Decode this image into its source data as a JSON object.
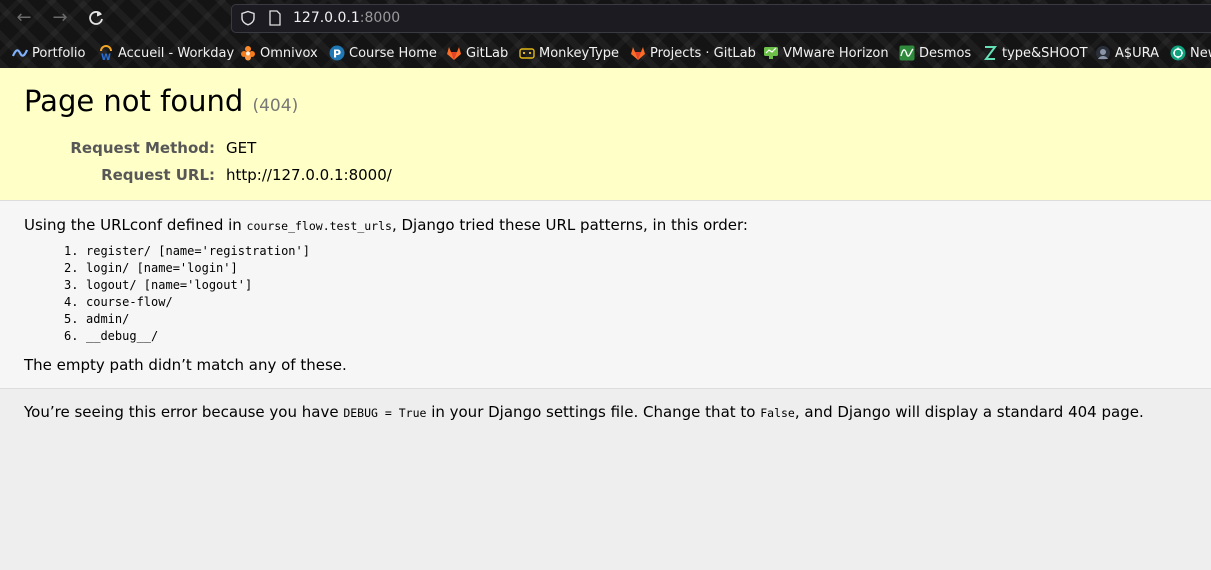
{
  "browser": {
    "url_host": "127.0.0.1",
    "url_port": ":8000",
    "bookmarks": [
      {
        "label": "Portfolio",
        "icon": "portfolio-icon"
      },
      {
        "label": "Accueil - Workday",
        "icon": "workday-icon"
      },
      {
        "label": "Omnivox",
        "icon": "omnivox-icon"
      },
      {
        "label": "Course Home",
        "icon": "pearson-icon"
      },
      {
        "label": "GitLab",
        "icon": "gitlab-icon"
      },
      {
        "label": "MonkeyType",
        "icon": "monkeytype-icon"
      },
      {
        "label": "Projects · GitLab",
        "icon": "gitlab-icon"
      },
      {
        "label": "VMware Horizon",
        "icon": "vmware-horizon-icon"
      },
      {
        "label": "Desmos",
        "icon": "desmos-icon"
      },
      {
        "label": "type&SHOOT",
        "icon": "typeshoot-icon"
      },
      {
        "label": "A$URA",
        "icon": "asura-icon"
      },
      {
        "label": "New",
        "icon": "chatgpt-icon"
      }
    ]
  },
  "summary": {
    "title": "Page not found",
    "code": "(404)",
    "request_method_label": "Request Method:",
    "request_method": "GET",
    "request_url_label": "Request URL:",
    "request_url": "http://127.0.0.1:8000/"
  },
  "info": {
    "intro_before": "Using the URLconf defined in ",
    "urlconf": "course_flow.test_urls",
    "intro_after": ", Django tried these URL patterns, in this order:",
    "patterns": [
      {
        "num": "1.",
        "text": "register/ [name='registration']"
      },
      {
        "num": "2.",
        "text": "login/ [name='login']"
      },
      {
        "num": "3.",
        "text": "logout/ [name='logout']"
      },
      {
        "num": "4.",
        "text": "course-flow/"
      },
      {
        "num": "5.",
        "text": "admin/"
      },
      {
        "num": "6.",
        "text": "__debug__/"
      }
    ],
    "outro": "The empty path didn’t match any of these."
  },
  "explanation": {
    "part1": "You’re seeing this error because you have ",
    "debug_code": "DEBUG = True",
    "part2": " in your Django settings file. Change that to ",
    "false_code": "False",
    "part3": ", and Django will display a standard 404 page."
  }
}
